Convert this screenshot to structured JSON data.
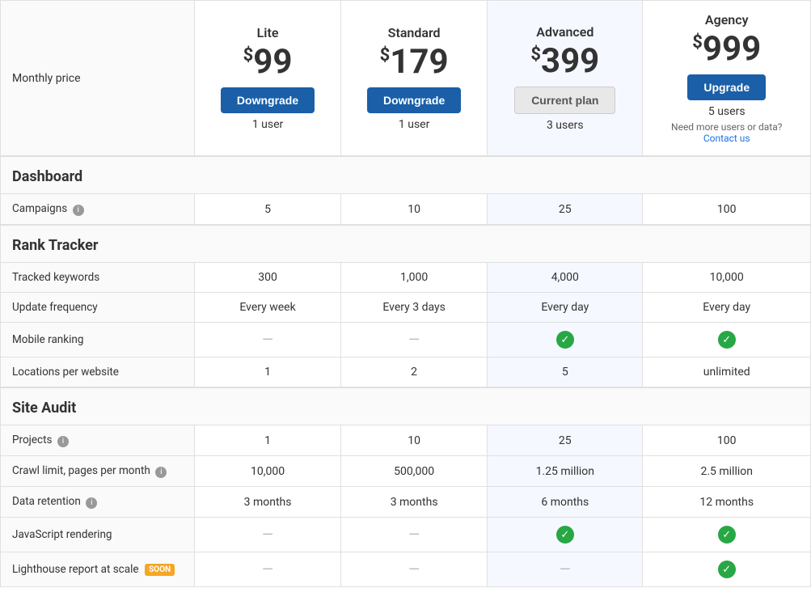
{
  "plans": [
    {
      "id": "lite",
      "name": "Lite",
      "price": "99",
      "button_label": "Downgrade",
      "button_type": "downgrade",
      "users": "1 user",
      "is_current": false
    },
    {
      "id": "standard",
      "name": "Standard",
      "price": "179",
      "button_label": "Downgrade",
      "button_type": "downgrade",
      "users": "1 user",
      "is_current": false
    },
    {
      "id": "advanced",
      "name": "Advanced",
      "price": "399",
      "button_label": "Current plan",
      "button_type": "current",
      "users": "3 users",
      "is_current": true
    },
    {
      "id": "agency",
      "name": "Agency",
      "price": "999",
      "button_label": "Upgrade",
      "button_type": "upgrade",
      "users": "5 users",
      "is_current": false,
      "extra_text": "Need more users or data?",
      "contact_label": "Contact us"
    }
  ],
  "sections": {
    "monthly_price_label": "Monthly price",
    "dashboard_label": "Dashboard",
    "rank_tracker_label": "Rank Tracker",
    "site_audit_label": "Site Audit"
  },
  "features": {
    "campaigns": {
      "label": "Campaigns",
      "has_info": true,
      "values": [
        "5",
        "10",
        "25",
        "100"
      ]
    },
    "tracked_keywords": {
      "label": "Tracked keywords",
      "values": [
        "300",
        "1,000",
        "4,000",
        "10,000"
      ]
    },
    "update_frequency": {
      "label": "Update frequency",
      "values": [
        "Every week",
        "Every 3 days",
        "Every day",
        "Every day"
      ]
    },
    "mobile_ranking": {
      "label": "Mobile ranking",
      "values": [
        "dash",
        "dash",
        "check",
        "check"
      ]
    },
    "locations_per_website": {
      "label": "Locations per website",
      "values": [
        "1",
        "2",
        "5",
        "unlimited"
      ]
    },
    "projects": {
      "label": "Projects",
      "has_info": true,
      "values": [
        "1",
        "10",
        "25",
        "100"
      ]
    },
    "crawl_limit": {
      "label": "Crawl limit, pages per month",
      "has_info": true,
      "values": [
        "10,000",
        "500,000",
        "1.25 million",
        "2.5 million"
      ]
    },
    "data_retention": {
      "label": "Data retention",
      "has_info": true,
      "values": [
        "3 months",
        "3 months",
        "6 months",
        "12 months"
      ]
    },
    "js_rendering": {
      "label": "JavaScript rendering",
      "values": [
        "dash",
        "dash",
        "check",
        "check"
      ]
    },
    "lighthouse_report": {
      "label": "Lighthouse report at scale",
      "has_soon": true,
      "values": [
        "dash",
        "dash",
        "dash",
        "check"
      ]
    }
  }
}
